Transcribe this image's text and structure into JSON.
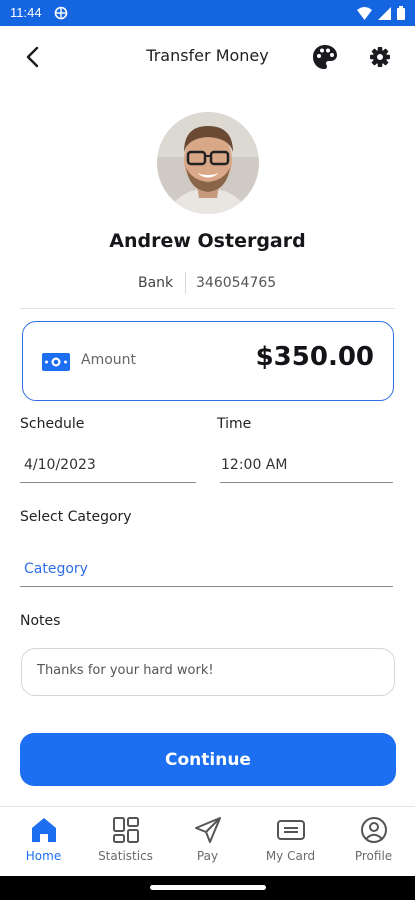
{
  "status_bar": {
    "time": "11:44"
  },
  "header": {
    "title": "Transfer Money"
  },
  "recipient": {
    "name": "Andrew Ostergard",
    "bank_label": "Bank",
    "account_number": "346054765"
  },
  "amount": {
    "label": "Amount",
    "value": "$350.00"
  },
  "schedule": {
    "label": "Schedule",
    "value": "4/10/2023"
  },
  "time": {
    "label": "Time",
    "value": "12:00 AM"
  },
  "category": {
    "label": "Select Category",
    "placeholder": "Category"
  },
  "notes": {
    "label": "Notes",
    "value": "Thanks for your hard work!"
  },
  "continue_label": "Continue",
  "nav": {
    "items": [
      {
        "label": "Home",
        "icon": "home-icon",
        "active": true
      },
      {
        "label": "Statistics",
        "icon": "statistics-icon",
        "active": false
      },
      {
        "label": "Pay",
        "icon": "send-icon",
        "active": false
      },
      {
        "label": "My Card",
        "icon": "card-icon",
        "active": false
      },
      {
        "label": "Profile",
        "icon": "profile-icon",
        "active": false
      }
    ]
  },
  "colors": {
    "primary": "#1b6ff0",
    "status_bar": "#1565e0",
    "card_border": "#2f6fe6"
  }
}
